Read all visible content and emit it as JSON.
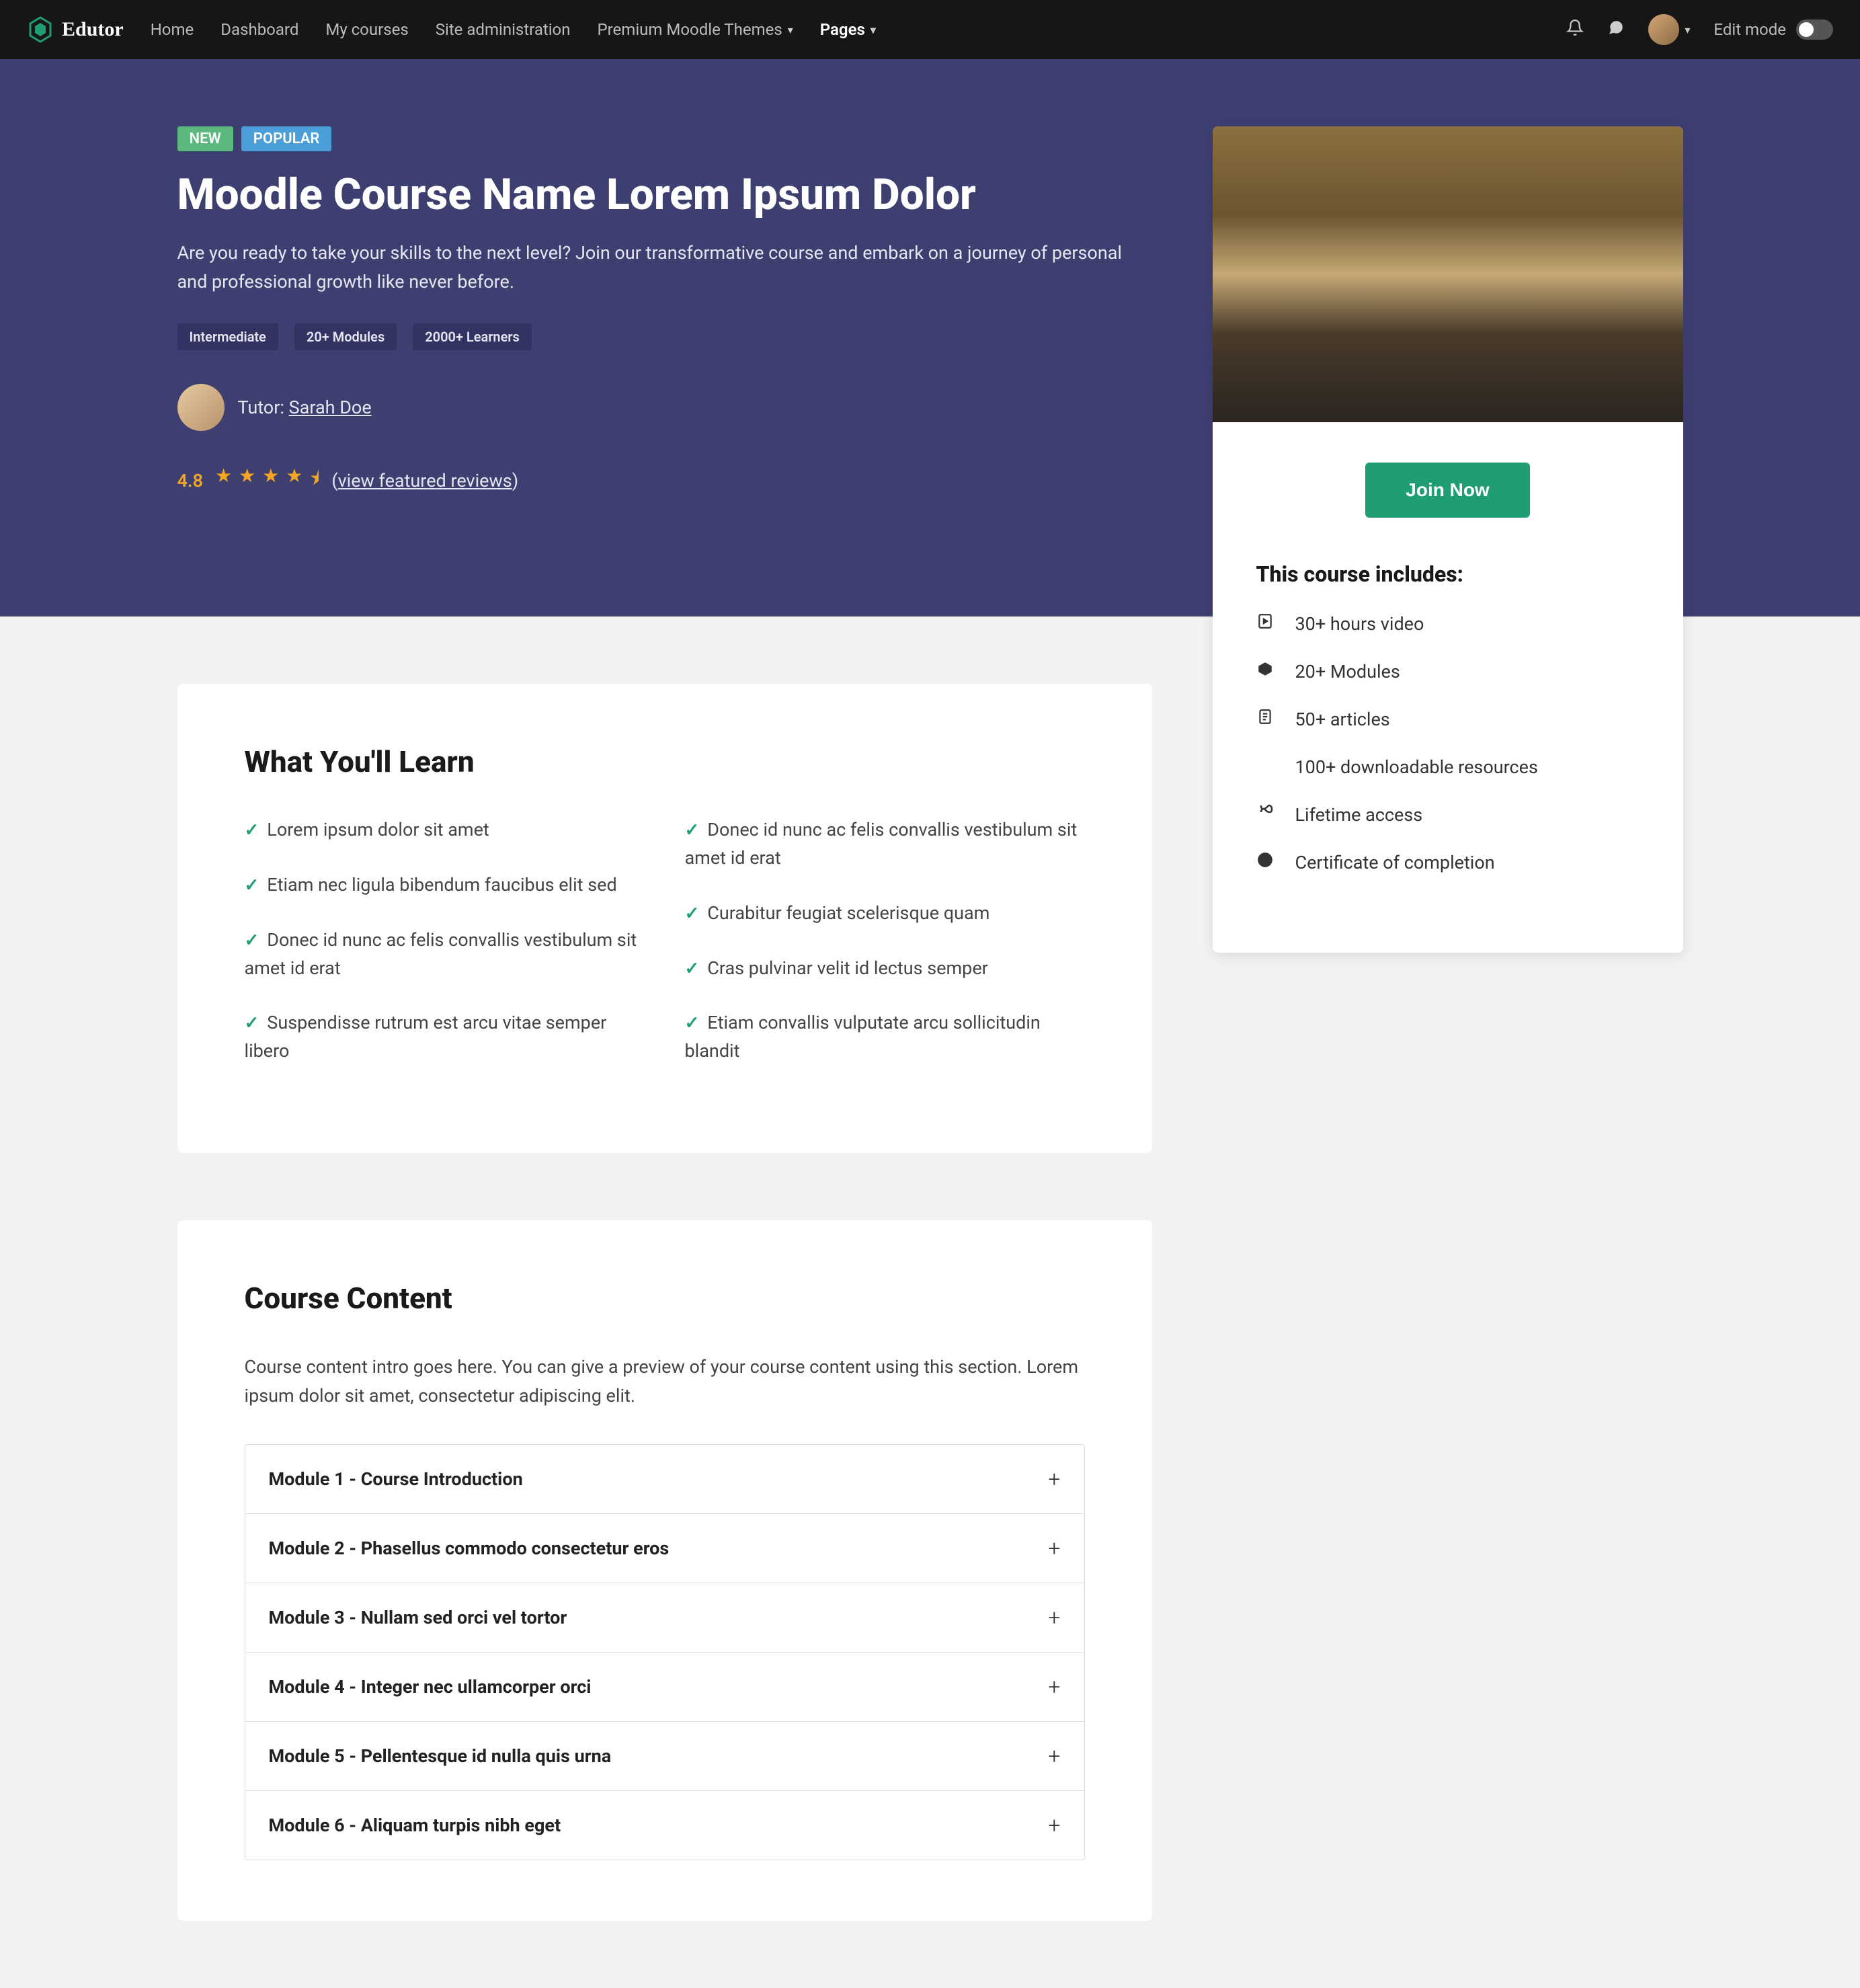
{
  "nav": {
    "brand": "Edutor",
    "links": [
      "Home",
      "Dashboard",
      "My courses",
      "Site administration",
      "Premium Moodle Themes",
      "Pages"
    ],
    "edit_mode_label": "Edit mode"
  },
  "hero": {
    "badge_new": "NEW",
    "badge_popular": "POPULAR",
    "title": "Moodle Course Name Lorem Ipsum Dolor",
    "desc": "Are you ready to take your skills to the next level? Join our transformative course and embark on a journey of personal and professional growth like never before.",
    "tags": [
      "Intermediate",
      "20+ Modules",
      "2000+ Learners"
    ],
    "tutor_prefix": "Tutor: ",
    "tutor_name": "Sarah Doe",
    "rating": "4.8",
    "reviews_text": "view featured reviews"
  },
  "card": {
    "join_label": "Join Now",
    "includes_title": "This course includes:",
    "includes": [
      "30+ hours video",
      "20+ Modules",
      "50+ articles",
      "100+ downloadable resources",
      "Lifetime access",
      "Certificate of completion"
    ]
  },
  "learn": {
    "title": "What You'll Learn",
    "left": [
      "Lorem ipsum dolor sit amet",
      "Etiam nec ligula bibendum faucibus elit sed",
      "Donec id nunc ac felis convallis vestibulum sit amet id erat",
      "Suspendisse rutrum est arcu vitae semper libero"
    ],
    "right": [
      "Donec id nunc ac felis convallis vestibulum sit amet id erat",
      "Curabitur feugiat scelerisque quam",
      "Cras pulvinar velit id lectus semper",
      "Etiam convallis vulputate arcu sollicitudin blandit"
    ]
  },
  "content": {
    "title": "Course Content",
    "intro": "Course content intro goes here. You can give a preview of your course content using this section. Lorem ipsum dolor sit amet, consectetur adipiscing elit.",
    "modules": [
      "Module 1 - Course Introduction",
      "Module 2 - Phasellus commodo consectetur eros",
      "Module 3 - Nullam sed orci vel tortor",
      "Module 4 - Integer nec ullamcorper orci",
      "Module 5 - Pellentesque id nulla quis urna",
      "Module 6 - Aliquam turpis nibh eget"
    ]
  }
}
